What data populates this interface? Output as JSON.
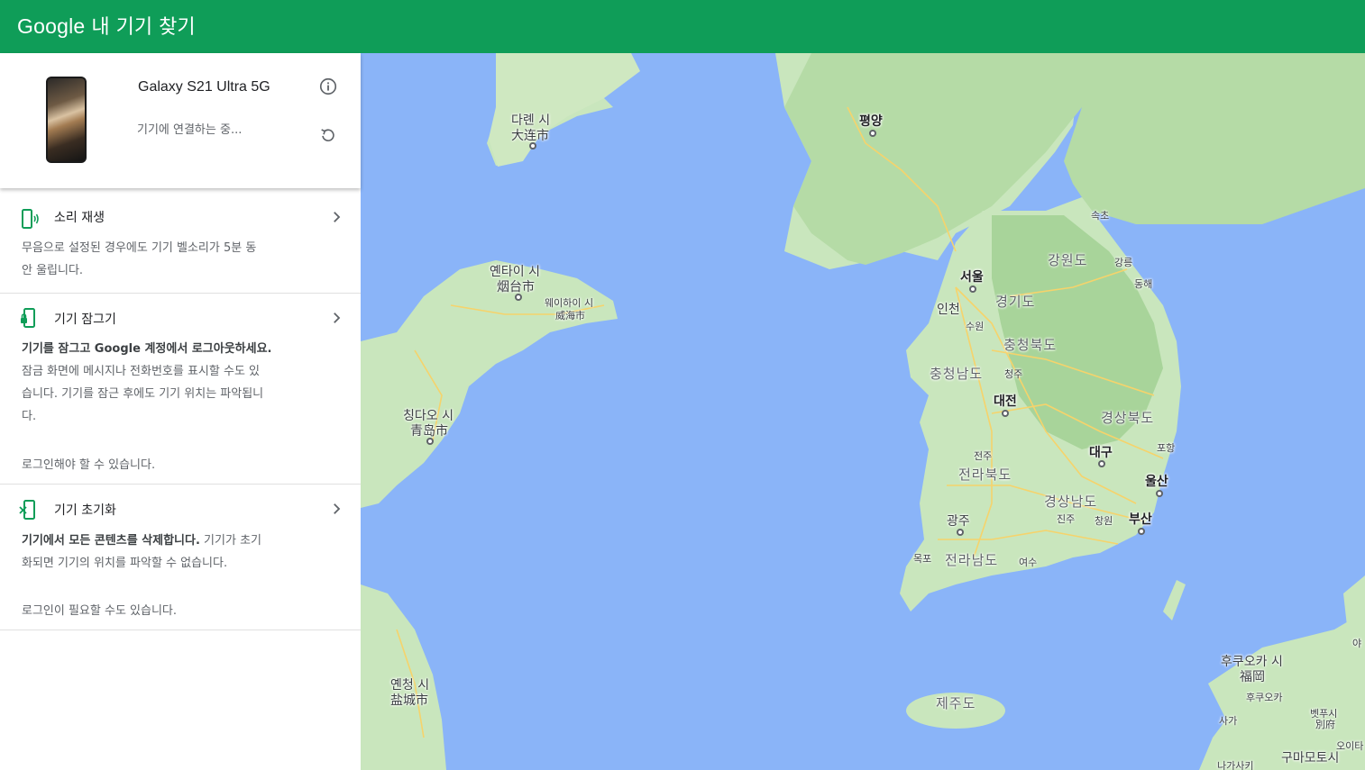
{
  "header": {
    "brand_google": "Google",
    "brand_product": "내 기기 찾기",
    "color": "#0f9d58"
  },
  "device": {
    "name": "Galaxy S21 Ultra 5G",
    "status": "기기에 연결하는 중...",
    "info_icon": "info-icon",
    "refresh_icon": "refresh-icon"
  },
  "actions": {
    "play_sound": {
      "title": "소리 재생",
      "desc_line1": "무음으로 설정된 경우에도 기기 벨소리가 5분 동",
      "desc_line2": "안 울립니다."
    },
    "lock": {
      "title": "기기 잠그기",
      "desc_bold": "기기를 잠그고 Google 계정에서 로그아웃하세요.",
      "desc_line2": "잠금 화면에 메시지나 전화번호를 표시할 수도 있",
      "desc_line3": "습니다. 기기를 잠근 후에도 기기 위치는 파악됩니",
      "desc_line4": "다.",
      "note": "로그인해야 할 수 있습니다."
    },
    "erase": {
      "title": "기기 초기화",
      "desc_bold": "기기에서 모든 콘텐츠를 삭제합니다.",
      "desc_rest": " 기기가 초기",
      "desc_line2": "화되면 기기의 위치를 파악할 수 없습니다.",
      "note": "로그인이 필요할 수도 있습니다."
    }
  },
  "map_labels": {
    "dalian_ko": "다롄 시",
    "dalian_zh": "大连市",
    "pyongyang": "평양",
    "yantai_ko": "옌타이 시",
    "yantai_zh": "烟台市",
    "weihai_ko": "웨이하이 시",
    "weihai_zh": "威海市",
    "qingdao_ko": "칭다오 시",
    "qingdao_zh": "青岛市",
    "yancheng_ko": "옌청 시",
    "yancheng_zh": "盐城市",
    "sokcho": "속초",
    "gangwon": "강원도",
    "gangneung": "강릉",
    "donghae": "동해",
    "seoul": "서울",
    "incheon": "인천",
    "gyeonggi": "경기도",
    "suwon": "수원",
    "chungbuk": "충청북도",
    "chungnam": "충청남도",
    "cheongju": "청주",
    "daejeon": "대전",
    "gyeongbuk": "경상북도",
    "daegu": "대구",
    "pohang": "포항",
    "jeonju": "전주",
    "jeonbuk": "전라북도",
    "ulsan": "울산",
    "gyeongnam": "경상남도",
    "gwangju": "광주",
    "jinju": "진주",
    "changwon": "창원",
    "busan": "부산",
    "mokpo": "목포",
    "jeonnam": "전라남도",
    "yeosu": "여수",
    "jeju": "제주도",
    "fukuoka_ko": "후쿠오카 시",
    "fukuoka_ja": "福岡",
    "fukuoka_small": "후쿠오카",
    "saga": "사가",
    "beppu": "벳푸시",
    "beppu_ja": "別府",
    "oita": "오이타",
    "nagasaki": "나가사키",
    "kumamoto": "구마모토시",
    "ya": "야"
  }
}
